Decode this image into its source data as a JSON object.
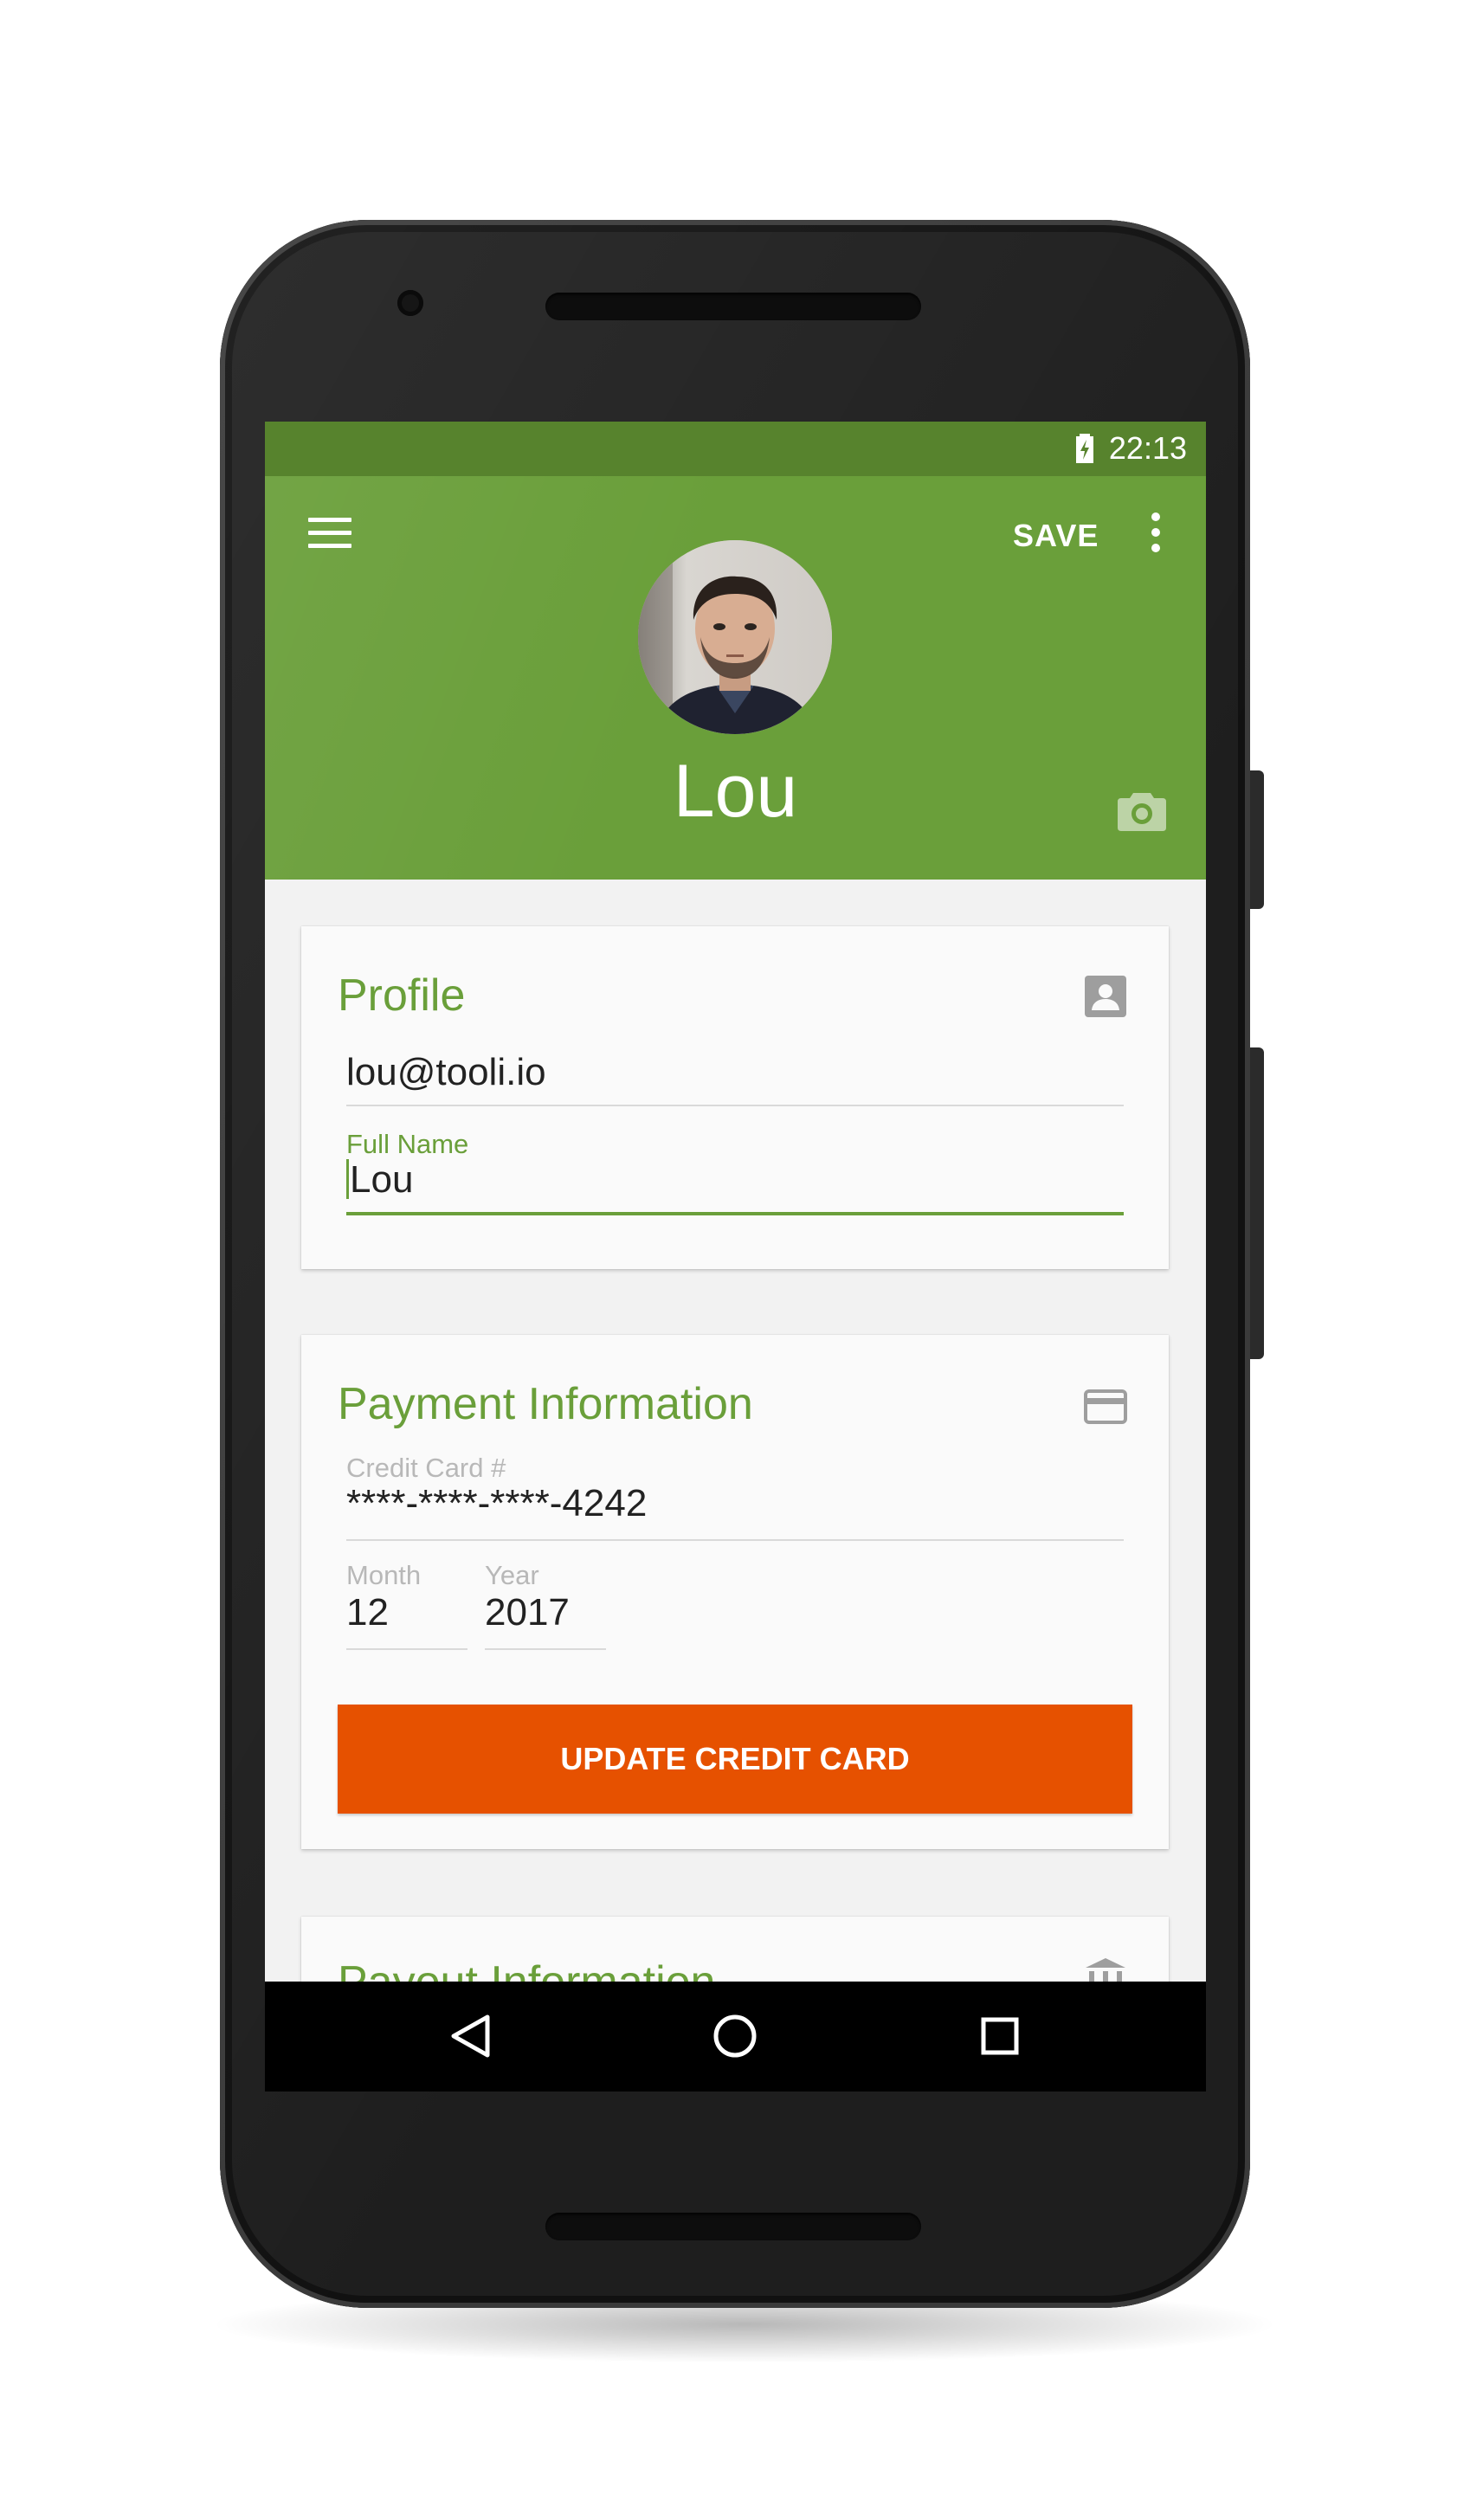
{
  "status_bar": {
    "time": "22:13"
  },
  "toolbar": {
    "menu_icon": "hamburger-menu-icon",
    "save_label": "SAVE",
    "overflow_icon": "more-vert-icon"
  },
  "profile_header": {
    "name": "Lou",
    "avatar": "user-photo",
    "camera_icon": "camera-icon"
  },
  "profile_card": {
    "title": "Profile",
    "icon": "account-box-icon",
    "email": "lou@tooli.io",
    "full_name_label": "Full Name",
    "full_name_value": "Lou"
  },
  "payment_card": {
    "title": "Payment Information",
    "icon": "credit-card-icon",
    "card_label": "Credit Card #",
    "card_value": "****-****-****-4242",
    "month_label": "Month",
    "month_value": "12",
    "year_label": "Year",
    "year_value": "2017",
    "button_label": "UPDATE CREDIT CARD"
  },
  "payout_card": {
    "title": "Payout Information",
    "icon": "bank-icon"
  },
  "nav_bar": {
    "back_icon": "back-triangle-icon",
    "home_icon": "home-circle-icon",
    "recents_icon": "recents-square-icon"
  },
  "colors": {
    "primary": "#6a9f3a",
    "primary_dark": "#57832d",
    "accent": "#e65100"
  }
}
